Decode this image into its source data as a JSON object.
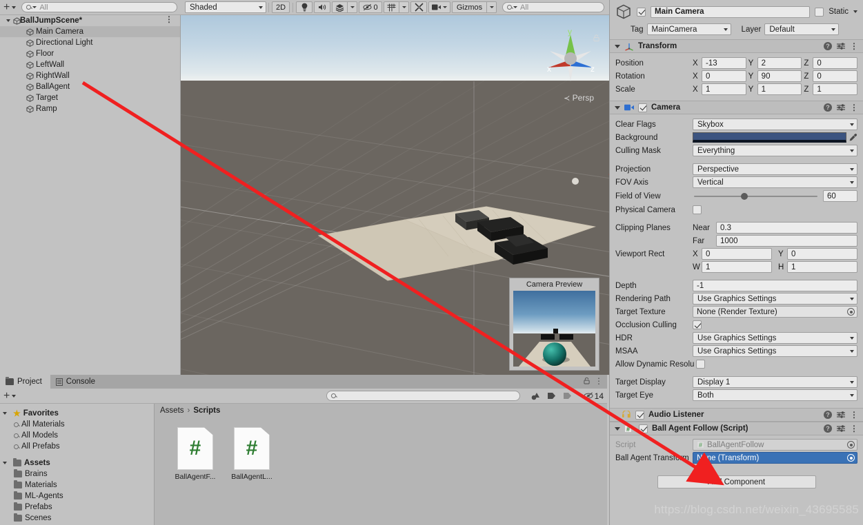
{
  "hierarchy": {
    "toolbar": {
      "create_label": "+",
      "search_placeholder": "All"
    },
    "scene_name": "BallJumpScene*",
    "items": [
      {
        "label": "Main Camera",
        "selected": true
      },
      {
        "label": "Directional Light",
        "selected": false
      },
      {
        "label": "Floor",
        "selected": false
      },
      {
        "label": "LeftWall",
        "selected": false
      },
      {
        "label": "RightWall",
        "selected": false
      },
      {
        "label": "BallAgent",
        "selected": false
      },
      {
        "label": "Target",
        "selected": false
      },
      {
        "label": "Ramp",
        "selected": false
      }
    ]
  },
  "scene_toolbar": {
    "draw_mode": "Shaded",
    "mode_2d": "2D",
    "lighting_icon": "lightbulb-icon",
    "audio_icon": "speaker-icon",
    "fx_icon": "effects-icon",
    "hidden_count": "0",
    "grid_icon": "grid-icon",
    "tools_icon": "scene-tools-icon",
    "camera_icon": "scene-camera-icon",
    "gizmos_label": "Gizmos",
    "search_placeholder": "All"
  },
  "scene_view": {
    "gizmo_axes": {
      "x": "x",
      "y": "y",
      "z": "z"
    },
    "projection_label": "Persp",
    "lock_icon": "padlock-icon",
    "camera_preview_title": "Camera Preview"
  },
  "project": {
    "tabs": [
      {
        "label": "Project",
        "active": true,
        "icon": "folder-icon"
      },
      {
        "label": "Console",
        "active": false,
        "icon": "console-icon"
      }
    ],
    "lock_icon": "padlock-icon",
    "kebab_icon": "kebab-menu-icon",
    "toolbar": {
      "create_label": "+",
      "search_placeholder": ""
    },
    "filter_icons": [
      "search-by-type-icon",
      "search-by-label-icon",
      "search-in-packages-icon"
    ],
    "hidden_packages_count": "14",
    "tree": [
      {
        "label": "Favorites",
        "depth": 0,
        "bold": true,
        "icon": "star-icon",
        "expanded": true
      },
      {
        "label": "All Materials",
        "depth": 1,
        "bold": false,
        "icon": "search-icon"
      },
      {
        "label": "All Models",
        "depth": 1,
        "bold": false,
        "icon": "search-icon"
      },
      {
        "label": "All Prefabs",
        "depth": 1,
        "bold": false,
        "icon": "search-icon"
      },
      {
        "label": "",
        "depth": 0,
        "spacer": true
      },
      {
        "label": "Assets",
        "depth": 0,
        "bold": true,
        "icon": "folder-icon",
        "expanded": true
      },
      {
        "label": "Brains",
        "depth": 1,
        "bold": false,
        "icon": "folder-icon"
      },
      {
        "label": "Materials",
        "depth": 1,
        "bold": false,
        "icon": "folder-icon"
      },
      {
        "label": "ML-Agents",
        "depth": 1,
        "bold": false,
        "icon": "folder-icon",
        "collapsed": true
      },
      {
        "label": "Prefabs",
        "depth": 1,
        "bold": false,
        "icon": "folder-icon"
      },
      {
        "label": "Scenes",
        "depth": 1,
        "bold": false,
        "icon": "folder-icon"
      }
    ],
    "breadcrumb": [
      "Assets",
      "Scripts"
    ],
    "assets": [
      {
        "name": "BallAgentF...",
        "type": "csharp-script"
      },
      {
        "name": "BallAgentL...",
        "type": "csharp-script"
      }
    ]
  },
  "inspector": {
    "object": {
      "enabled": true,
      "name": "Main Camera",
      "static_label": "Static",
      "static_checked": false,
      "tag_label": "Tag",
      "tag_value": "MainCamera",
      "layer_label": "Layer",
      "layer_value": "Default"
    },
    "transform": {
      "title": "Transform",
      "expanded": true,
      "rows": [
        {
          "label": "Position",
          "x": "-13",
          "y": "2",
          "z": "0"
        },
        {
          "label": "Rotation",
          "x": "0",
          "y": "90",
          "z": "0"
        },
        {
          "label": "Scale",
          "x": "1",
          "y": "1",
          "z": "1"
        }
      ],
      "axis_labels": [
        "X",
        "Y",
        "Z"
      ]
    },
    "camera": {
      "title": "Camera",
      "enabled": true,
      "expanded": true,
      "clear_flags_label": "Clear Flags",
      "clear_flags_value": "Skybox",
      "background_label": "Background",
      "background_color": "#3c5480",
      "eyedropper_icon": "eyedropper-icon",
      "culling_mask_label": "Culling Mask",
      "culling_mask_value": "Everything",
      "projection_label": "Projection",
      "projection_value": "Perspective",
      "fov_axis_label": "FOV Axis",
      "fov_axis_value": "Vertical",
      "field_of_view_label": "Field of View",
      "field_of_view_value": "60",
      "physical_camera_label": "Physical Camera",
      "physical_camera_checked": false,
      "clipping_planes_label": "Clipping Planes",
      "near_label": "Near",
      "near_value": "0.3",
      "far_label": "Far",
      "far_value": "1000",
      "viewport_rect_label": "Viewport Rect",
      "viewport_x_label": "X",
      "viewport_x": "0",
      "viewport_y_label": "Y",
      "viewport_y": "0",
      "viewport_w_label": "W",
      "viewport_w": "1",
      "viewport_h_label": "H",
      "viewport_h": "1",
      "depth_label": "Depth",
      "depth_value": "-1",
      "rendering_path_label": "Rendering Path",
      "rendering_path_value": "Use Graphics Settings",
      "target_texture_label": "Target Texture",
      "target_texture_value": "None (Render Texture)",
      "occlusion_culling_label": "Occlusion Culling",
      "occlusion_culling_checked": true,
      "hdr_label": "HDR",
      "hdr_value": "Use Graphics Settings",
      "msaa_label": "MSAA",
      "msaa_value": "Use Graphics Settings",
      "allow_dynamic_resolution_label": "Allow Dynamic Resolu",
      "allow_dynamic_resolution_checked": false,
      "target_display_label": "Target Display",
      "target_display_value": "Display 1",
      "target_eye_label": "Target Eye",
      "target_eye_value": "Both"
    },
    "audio_listener": {
      "title": "Audio Listener",
      "enabled": true
    },
    "script_component": {
      "title": "Ball Agent Follow (Script)",
      "enabled": true,
      "expanded": true,
      "script_label": "Script",
      "script_value": "BallAgentFollow",
      "field_label": "Ball Agent Transform",
      "field_value": "None (Transform)",
      "field_highlighted": true
    },
    "add_component_label": "Add Component",
    "help_icon": "help-icon",
    "preset_icon": "preset-icon",
    "kebab_icon": "kebab-menu-icon"
  },
  "watermark": "https://blog.csdn.net/weixin_43695585",
  "colors": {
    "panel": "#c2c2c2",
    "selection_blue": "#3a72b6",
    "annotation_red": "#f02020",
    "script_green": "#2e7d32"
  }
}
